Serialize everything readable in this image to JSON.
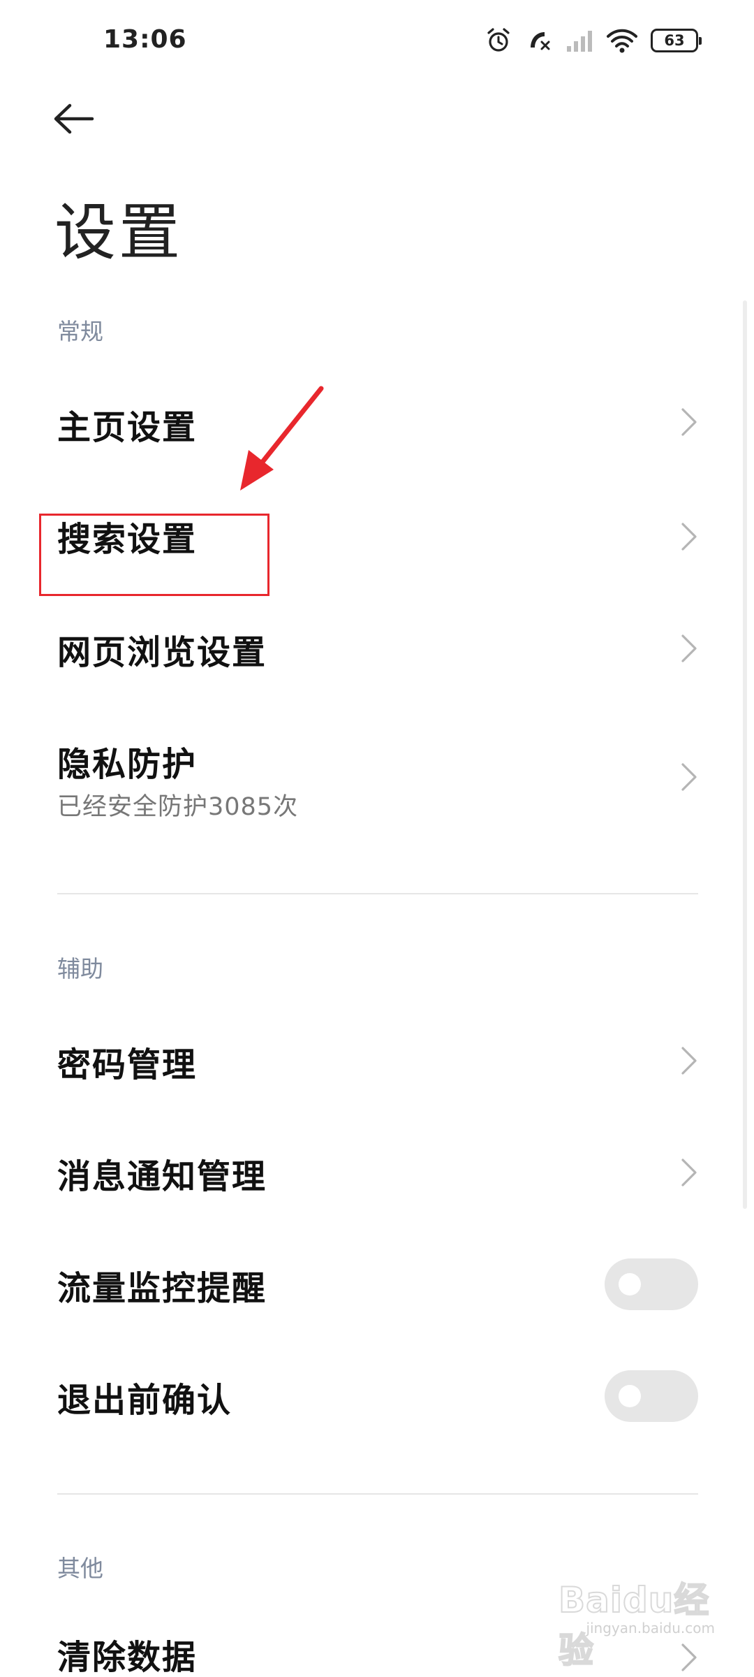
{
  "status_bar": {
    "time": "13:06",
    "icons": [
      "alarm-icon",
      "missed-call-icon",
      "signal-icon",
      "wifi-icon",
      "battery-icon"
    ],
    "battery_level": "63"
  },
  "header": {
    "back_icon": "back-arrow-icon",
    "title": "设置"
  },
  "sections": [
    {
      "header": "常规",
      "items": [
        {
          "label": "主页设置",
          "control": "chevron"
        },
        {
          "label": "搜索设置",
          "control": "chevron"
        },
        {
          "label": "网页浏览设置",
          "control": "chevron"
        },
        {
          "label": "隐私防护",
          "sublabel": "已经安全防护3085次",
          "control": "chevron"
        }
      ]
    },
    {
      "header": "辅助",
      "items": [
        {
          "label": "密码管理",
          "control": "chevron"
        },
        {
          "label": "消息通知管理",
          "control": "chevron"
        },
        {
          "label": "流量监控提醒",
          "control": "toggle",
          "on": false
        },
        {
          "label": "退出前确认",
          "control": "toggle",
          "on": false
        }
      ]
    },
    {
      "header": "其他",
      "items": [
        {
          "label": "清除数据",
          "control": "chevron"
        }
      ]
    }
  ],
  "annotation": {
    "highlighted_item": "搜索设置",
    "color": "#e8272d"
  },
  "watermark": {
    "brand": "Baidu经验",
    "domain": "jingyan.baidu.com"
  },
  "colors": {
    "section_header": "#7f8a9d",
    "toggle_off": "#e6e6e6",
    "divider": "#e6e6e6"
  }
}
